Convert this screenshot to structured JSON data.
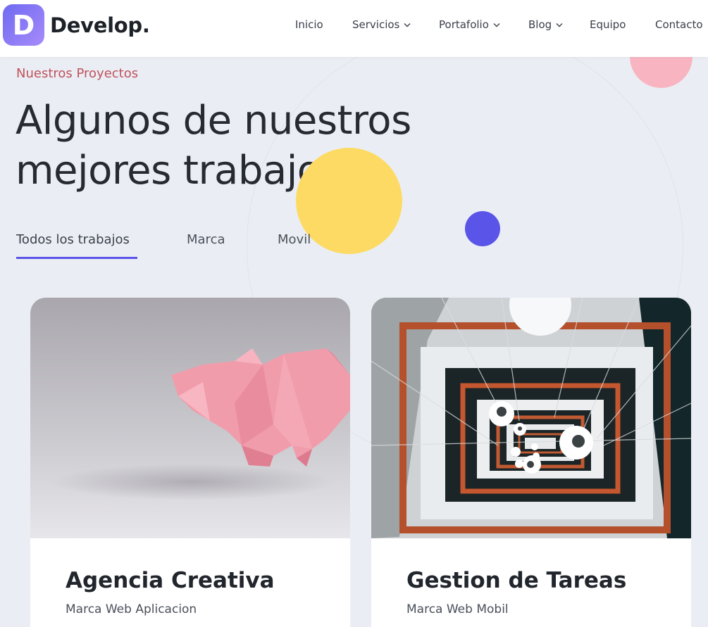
{
  "brand": {
    "logo_letter": "D",
    "name": "Develop."
  },
  "nav": {
    "items": [
      {
        "label": "Inicio",
        "has_dropdown": false
      },
      {
        "label": "Servicios",
        "has_dropdown": true
      },
      {
        "label": "Portafolio",
        "has_dropdown": true
      },
      {
        "label": "Blog",
        "has_dropdown": true
      },
      {
        "label": "Equipo",
        "has_dropdown": false
      },
      {
        "label": "Contacto",
        "has_dropdown": false
      }
    ]
  },
  "section": {
    "eyebrow": "Nuestros Proyectos",
    "headline_line1": "Algunos de nuestros",
    "headline_line2": "mejores trabajos"
  },
  "filters": {
    "active_index": 0,
    "tabs": [
      "Todos los trabajos",
      "Marca",
      "Movil"
    ]
  },
  "projects": [
    {
      "title": "Agencia Creativa",
      "tags": "Marca Web Aplicacion",
      "image": "origami-pig-image"
    },
    {
      "title": "Gestion de Tareas",
      "tags": "Marca Web Mobil",
      "image": "spiral-staircase-image"
    }
  ],
  "colors": {
    "accent": "#5b54e8",
    "eyebrow": "#c0515c",
    "yellow_dot": "#fdda63",
    "pink_dot": "#f8b5c1",
    "background": "#eaeef4"
  }
}
